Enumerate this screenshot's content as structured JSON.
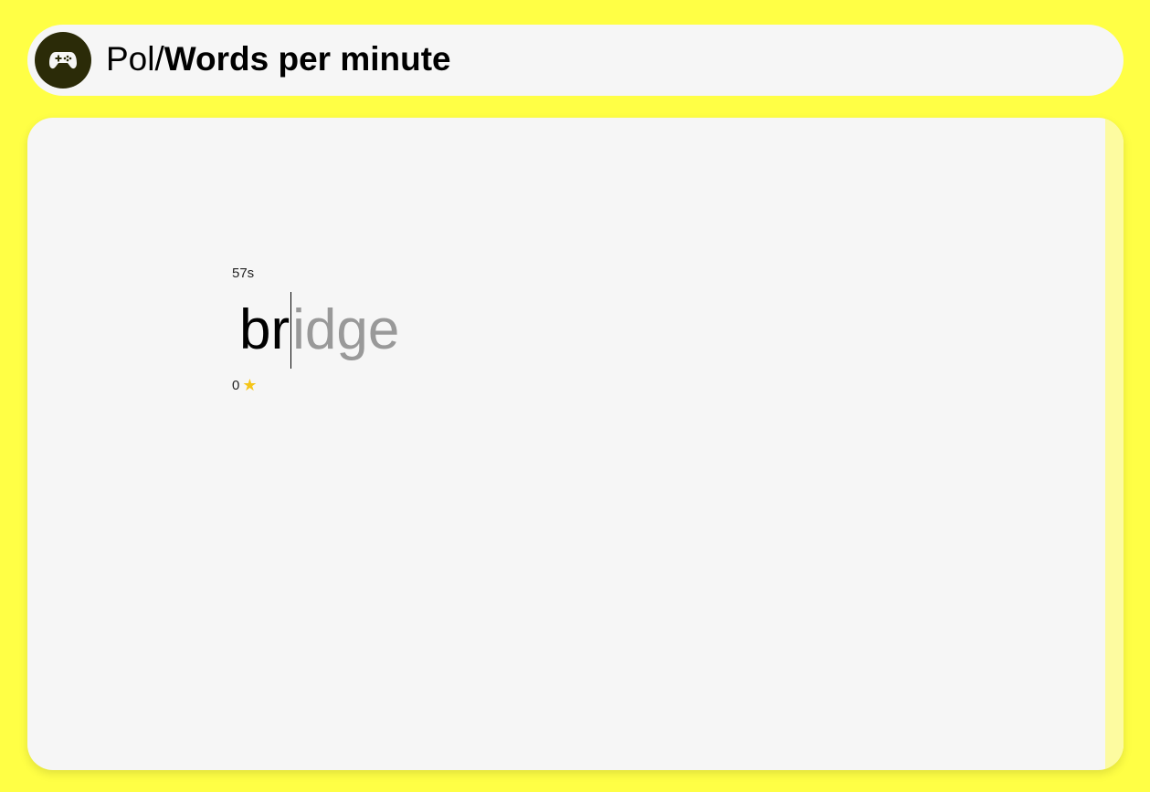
{
  "header": {
    "logo_icon": "gamepad-icon",
    "brand": "Pol/",
    "page_title": "Words per minute"
  },
  "game": {
    "timer": "57s",
    "word": {
      "typed": "br",
      "remaining": "idge"
    },
    "score": "0",
    "score_icon": "star-icon"
  },
  "colors": {
    "background": "#ffff45",
    "panel": "#f6f6f6",
    "logo_bg": "#2b2b08",
    "star": "#f5c518",
    "remaining_text": "#999999"
  }
}
